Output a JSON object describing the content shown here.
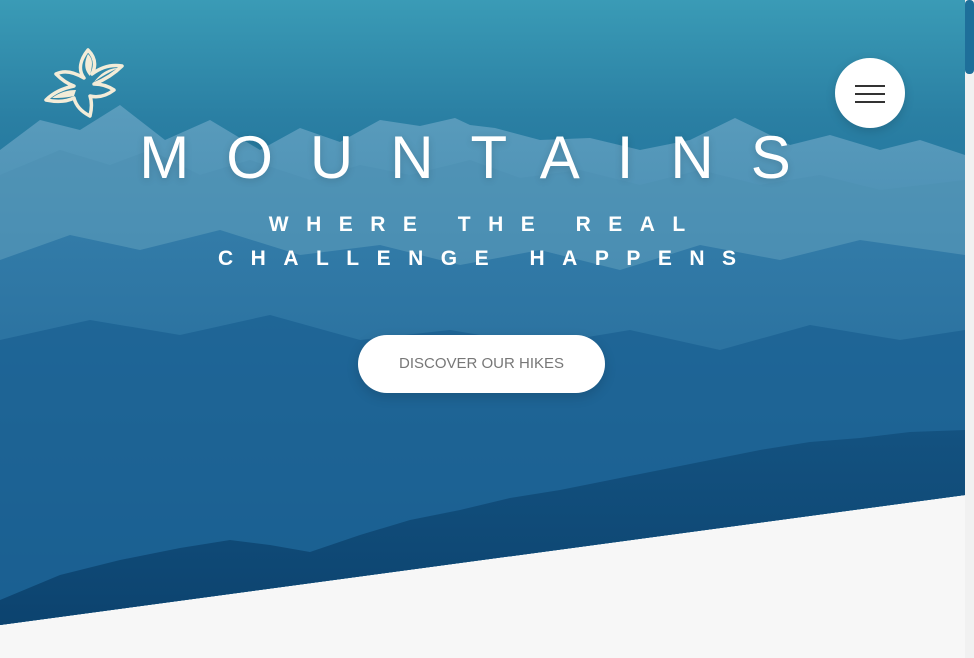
{
  "header": {
    "logo_icon": "leaf-logo-icon",
    "menu_icon": "hamburger-menu-icon"
  },
  "hero": {
    "title": "MOUNTAINS",
    "subtitle_line1": "WHERE THE REAL",
    "subtitle_line2": "CHALLENGE HAPPENS",
    "cta_label": "DISCOVER OUR HIKES"
  },
  "colors": {
    "hero_gradient_top": "#3a9bb6",
    "hero_gradient_bottom": "#0b4f83",
    "section_background": "#f7f7f7",
    "button_background": "#ffffff",
    "button_text": "#777777"
  }
}
